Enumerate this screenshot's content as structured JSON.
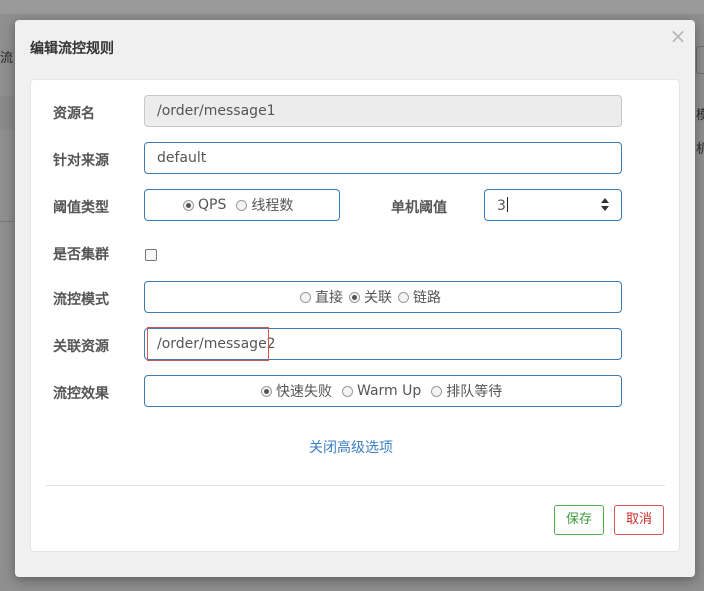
{
  "background": {
    "left_fragment": "流",
    "right_fragment_1": "模",
    "right_fragment_2": "机"
  },
  "dialog": {
    "title": "编辑流控规则",
    "close_glyph": "×"
  },
  "form": {
    "resource_name": {
      "label": "资源名",
      "value": "/order/message1",
      "disabled": true
    },
    "limit_app": {
      "label": "针对来源",
      "value": "default"
    },
    "grade": {
      "label": "阈值类型",
      "options": [
        {
          "label": "QPS",
          "selected": true
        },
        {
          "label": "线程数",
          "selected": false
        }
      ]
    },
    "threshold": {
      "label": "单机阈值",
      "value": "3"
    },
    "cluster_mode": {
      "label": "是否集群",
      "checked": false
    },
    "strategy": {
      "label": "流控模式",
      "options": [
        {
          "label": "直接",
          "selected": false
        },
        {
          "label": "关联",
          "selected": true
        },
        {
          "label": "链路",
          "selected": false
        }
      ]
    },
    "ref_resource": {
      "label": "关联资源",
      "value": "/order/message2"
    },
    "control_behavior": {
      "label": "流控效果",
      "options": [
        {
          "label": "快速失败",
          "selected": true
        },
        {
          "label": "Warm Up",
          "selected": false
        },
        {
          "label": "排队等待",
          "selected": false
        }
      ]
    },
    "advanced_link": "关闭高级选项"
  },
  "footer": {
    "save_label": "保存",
    "cancel_label": "取消"
  },
  "colors": {
    "field_border": "#3e7bb3",
    "link": "#3b7fc4",
    "save": "#4cae4c",
    "cancel": "#d9534f",
    "highlight_box": "#d9534f"
  }
}
